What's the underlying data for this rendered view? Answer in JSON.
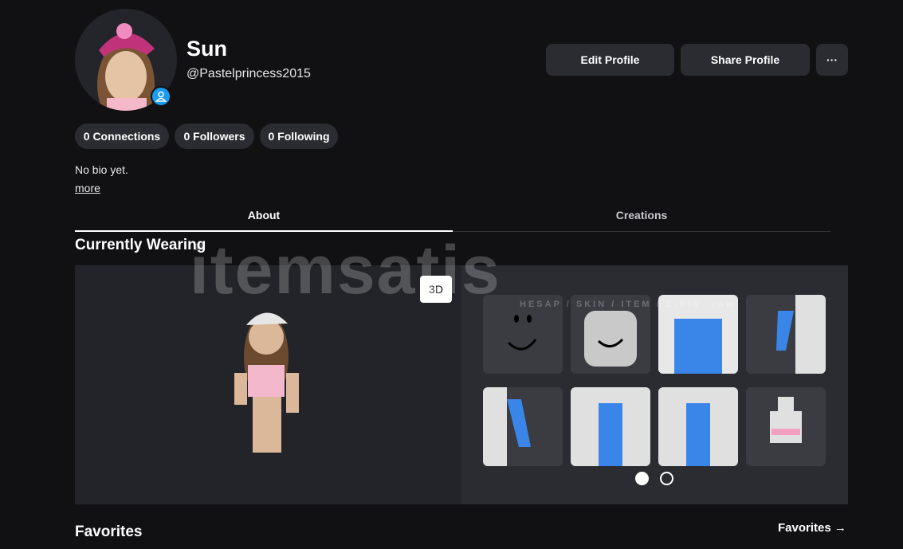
{
  "profile": {
    "display_name": "Sun",
    "username": "@Pastelprincess2015",
    "bio": "No bio yet.",
    "more_label": "more"
  },
  "actions": {
    "edit": "Edit Profile",
    "share": "Share Profile",
    "more": "···"
  },
  "stats": {
    "connections": "0 Connections",
    "followers": "0 Followers",
    "following": "0 Following"
  },
  "tabs": [
    {
      "label": "About",
      "active": true
    },
    {
      "label": "Creations",
      "active": false
    }
  ],
  "wearing": {
    "title": "Currently Wearing",
    "toggle_3d": "3D",
    "items": [
      "face",
      "head",
      "torso",
      "right-arm",
      "left-arm",
      "left-leg",
      "right-leg",
      "outfit"
    ],
    "page": 1,
    "pages": 2
  },
  "favorites": {
    "title": "Favorites",
    "link": "Favorites →"
  },
  "watermark": {
    "brand": "itemsatis",
    "tagline": "HESAP / SKIN / ITEM / E-PIN .com"
  }
}
